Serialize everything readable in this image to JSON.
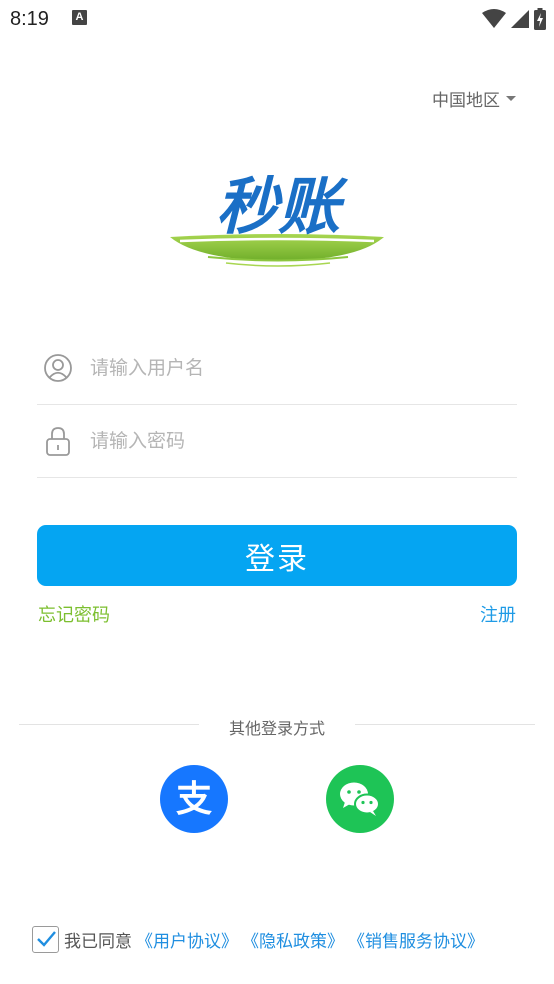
{
  "status_bar": {
    "time": "8:19",
    "notification_icon": "a-icon",
    "notification_letter": "A",
    "icons": [
      "wifi-icon",
      "signal-icon",
      "battery-icon"
    ]
  },
  "region": {
    "label": "中国地区",
    "icon": "caret-down-icon"
  },
  "logo": {
    "text": "秒账",
    "brand_blue": "#1a6fc6",
    "brand_green": "#8cc63f"
  },
  "form": {
    "username_placeholder": "请输入用户名",
    "username_icon": "user-icon",
    "password_placeholder": "请输入密码",
    "password_icon": "lock-icon",
    "login_label": "登录",
    "forgot_label": "忘记密码",
    "register_label": "注册"
  },
  "other_login": {
    "title": "其他登录方式",
    "alipay_glyph": "支",
    "alipay_icon": "alipay-icon",
    "wechat_icon": "wechat-icon"
  },
  "agreement": {
    "checked": true,
    "text": "我已同意",
    "links": [
      "《用户协议》",
      "《隐私政策》",
      "《销售服务协议》"
    ]
  },
  "colors": {
    "primary": "#05a5f2",
    "forgot": "#7cbf2f",
    "link": "#1f9be6",
    "alipay": "#1677ff",
    "wechat": "#1ec456"
  }
}
